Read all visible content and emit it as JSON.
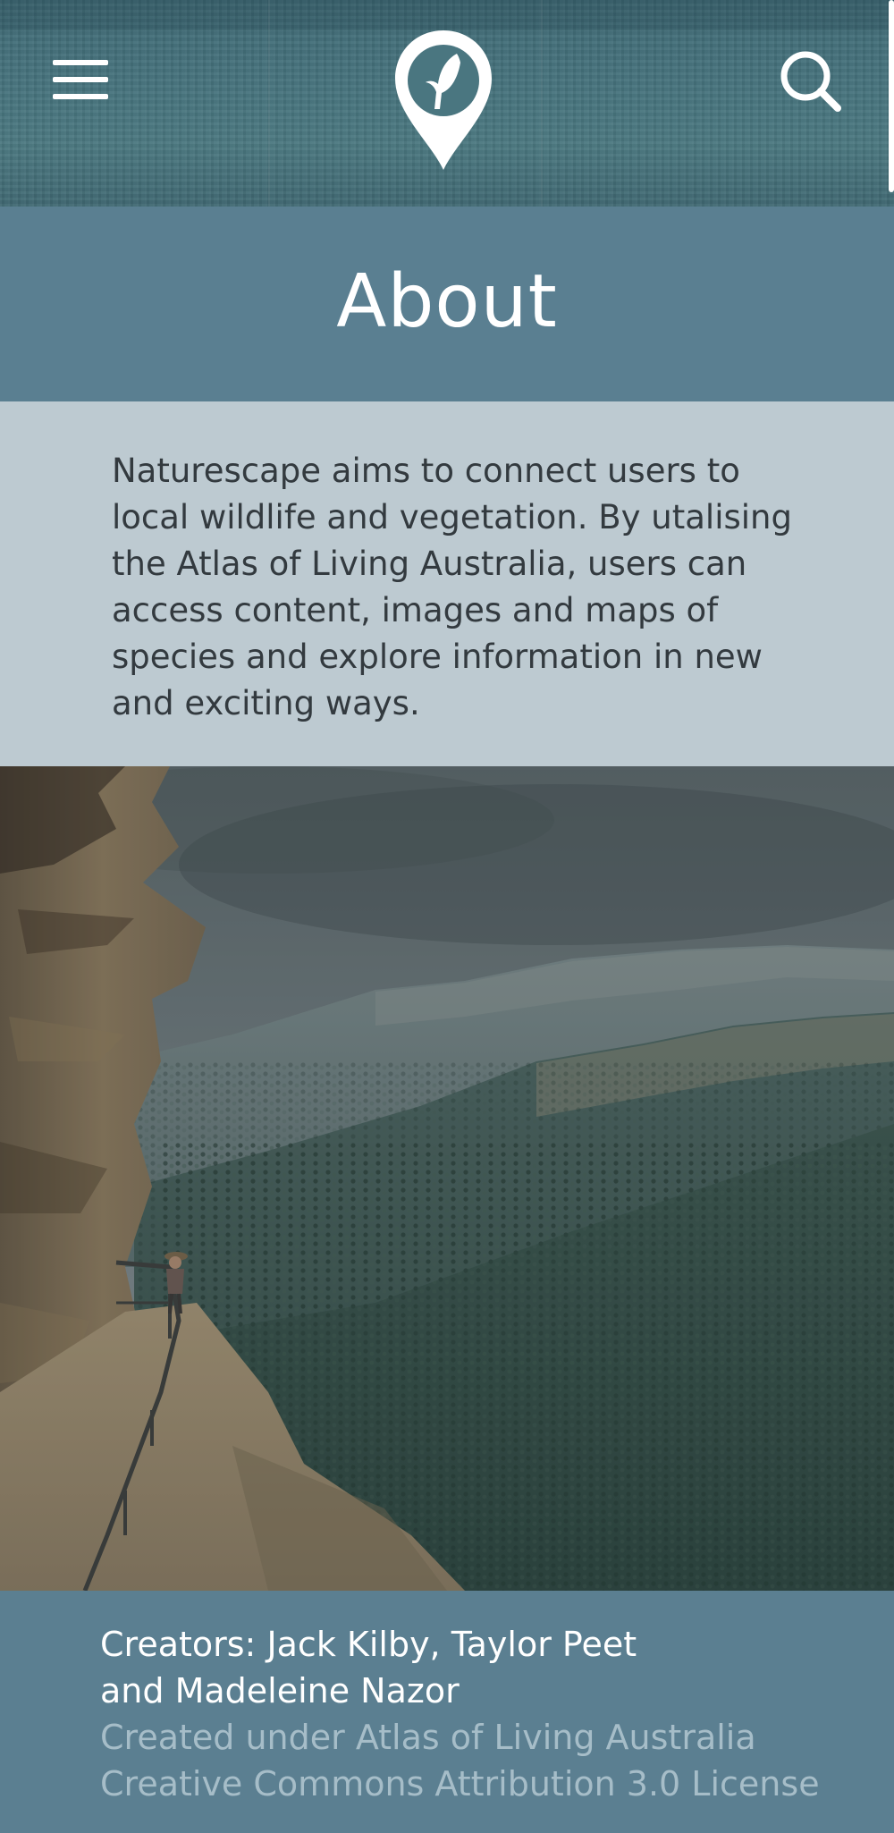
{
  "header": {
    "menu_icon": "hamburger-menu-icon",
    "logo_icon": "map-pin-leaf-logo",
    "search_icon": "search-icon"
  },
  "page": {
    "title": "About"
  },
  "intro": {
    "text": "Naturescape aims to connect users to local wildlife and vegetation. By utalising the Atlas of Living Australia, users can access content, images and maps of species and explore information in new and exciting ways."
  },
  "photo": {
    "subject": "cliff-edge-overlooking-forested-valley"
  },
  "footer": {
    "creators_line1": "Creators: Jack Kilby, Taylor Peet",
    "creators_line2": "and Madeleine Nazor",
    "license_line1": "Created under Atlas of Living Australia",
    "license_line2": "Creative Commons Attribution 3.0 License"
  },
  "colors": {
    "header_band": "#5a7f91",
    "intro_background": "#bdcad1",
    "footer_background": "#5b7f91",
    "license_text": "#a6bdc8"
  }
}
